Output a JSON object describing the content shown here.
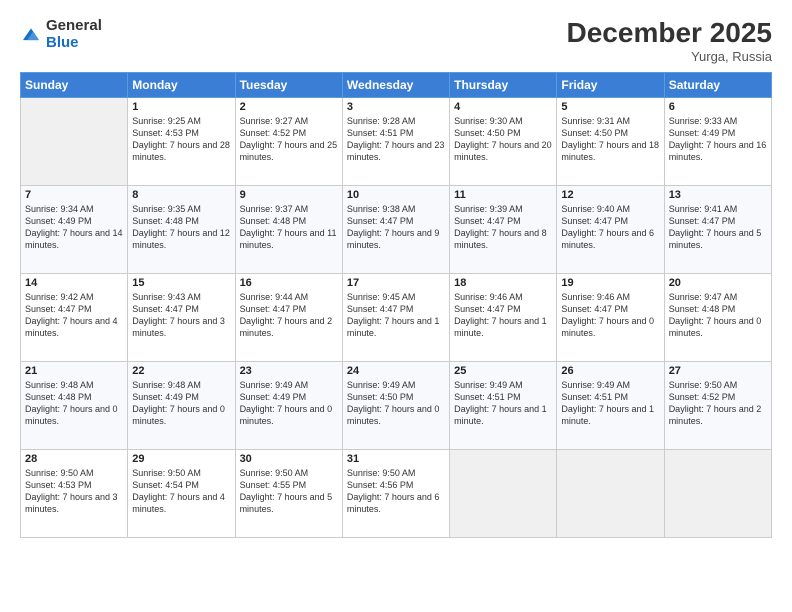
{
  "logo": {
    "general": "General",
    "blue": "Blue"
  },
  "title": "December 2025",
  "location": "Yurga, Russia",
  "headers": [
    "Sunday",
    "Monday",
    "Tuesday",
    "Wednesday",
    "Thursday",
    "Friday",
    "Saturday"
  ],
  "weeks": [
    [
      {
        "day": "",
        "sunrise": "",
        "sunset": "",
        "daylight": ""
      },
      {
        "day": "1",
        "sunrise": "Sunrise: 9:25 AM",
        "sunset": "Sunset: 4:53 PM",
        "daylight": "Daylight: 7 hours and 28 minutes."
      },
      {
        "day": "2",
        "sunrise": "Sunrise: 9:27 AM",
        "sunset": "Sunset: 4:52 PM",
        "daylight": "Daylight: 7 hours and 25 minutes."
      },
      {
        "day": "3",
        "sunrise": "Sunrise: 9:28 AM",
        "sunset": "Sunset: 4:51 PM",
        "daylight": "Daylight: 7 hours and 23 minutes."
      },
      {
        "day": "4",
        "sunrise": "Sunrise: 9:30 AM",
        "sunset": "Sunset: 4:50 PM",
        "daylight": "Daylight: 7 hours and 20 minutes."
      },
      {
        "day": "5",
        "sunrise": "Sunrise: 9:31 AM",
        "sunset": "Sunset: 4:50 PM",
        "daylight": "Daylight: 7 hours and 18 minutes."
      },
      {
        "day": "6",
        "sunrise": "Sunrise: 9:33 AM",
        "sunset": "Sunset: 4:49 PM",
        "daylight": "Daylight: 7 hours and 16 minutes."
      }
    ],
    [
      {
        "day": "7",
        "sunrise": "Sunrise: 9:34 AM",
        "sunset": "Sunset: 4:49 PM",
        "daylight": "Daylight: 7 hours and 14 minutes."
      },
      {
        "day": "8",
        "sunrise": "Sunrise: 9:35 AM",
        "sunset": "Sunset: 4:48 PM",
        "daylight": "Daylight: 7 hours and 12 minutes."
      },
      {
        "day": "9",
        "sunrise": "Sunrise: 9:37 AM",
        "sunset": "Sunset: 4:48 PM",
        "daylight": "Daylight: 7 hours and 11 minutes."
      },
      {
        "day": "10",
        "sunrise": "Sunrise: 9:38 AM",
        "sunset": "Sunset: 4:47 PM",
        "daylight": "Daylight: 7 hours and 9 minutes."
      },
      {
        "day": "11",
        "sunrise": "Sunrise: 9:39 AM",
        "sunset": "Sunset: 4:47 PM",
        "daylight": "Daylight: 7 hours and 8 minutes."
      },
      {
        "day": "12",
        "sunrise": "Sunrise: 9:40 AM",
        "sunset": "Sunset: 4:47 PM",
        "daylight": "Daylight: 7 hours and 6 minutes."
      },
      {
        "day": "13",
        "sunrise": "Sunrise: 9:41 AM",
        "sunset": "Sunset: 4:47 PM",
        "daylight": "Daylight: 7 hours and 5 minutes."
      }
    ],
    [
      {
        "day": "14",
        "sunrise": "Sunrise: 9:42 AM",
        "sunset": "Sunset: 4:47 PM",
        "daylight": "Daylight: 7 hours and 4 minutes."
      },
      {
        "day": "15",
        "sunrise": "Sunrise: 9:43 AM",
        "sunset": "Sunset: 4:47 PM",
        "daylight": "Daylight: 7 hours and 3 minutes."
      },
      {
        "day": "16",
        "sunrise": "Sunrise: 9:44 AM",
        "sunset": "Sunset: 4:47 PM",
        "daylight": "Daylight: 7 hours and 2 minutes."
      },
      {
        "day": "17",
        "sunrise": "Sunrise: 9:45 AM",
        "sunset": "Sunset: 4:47 PM",
        "daylight": "Daylight: 7 hours and 1 minute."
      },
      {
        "day": "18",
        "sunrise": "Sunrise: 9:46 AM",
        "sunset": "Sunset: 4:47 PM",
        "daylight": "Daylight: 7 hours and 1 minute."
      },
      {
        "day": "19",
        "sunrise": "Sunrise: 9:46 AM",
        "sunset": "Sunset: 4:47 PM",
        "daylight": "Daylight: 7 hours and 0 minutes."
      },
      {
        "day": "20",
        "sunrise": "Sunrise: 9:47 AM",
        "sunset": "Sunset: 4:48 PM",
        "daylight": "Daylight: 7 hours and 0 minutes."
      }
    ],
    [
      {
        "day": "21",
        "sunrise": "Sunrise: 9:48 AM",
        "sunset": "Sunset: 4:48 PM",
        "daylight": "Daylight: 7 hours and 0 minutes."
      },
      {
        "day": "22",
        "sunrise": "Sunrise: 9:48 AM",
        "sunset": "Sunset: 4:49 PM",
        "daylight": "Daylight: 7 hours and 0 minutes."
      },
      {
        "day": "23",
        "sunrise": "Sunrise: 9:49 AM",
        "sunset": "Sunset: 4:49 PM",
        "daylight": "Daylight: 7 hours and 0 minutes."
      },
      {
        "day": "24",
        "sunrise": "Sunrise: 9:49 AM",
        "sunset": "Sunset: 4:50 PM",
        "daylight": "Daylight: 7 hours and 0 minutes."
      },
      {
        "day": "25",
        "sunrise": "Sunrise: 9:49 AM",
        "sunset": "Sunset: 4:51 PM",
        "daylight": "Daylight: 7 hours and 1 minute."
      },
      {
        "day": "26",
        "sunrise": "Sunrise: 9:49 AM",
        "sunset": "Sunset: 4:51 PM",
        "daylight": "Daylight: 7 hours and 1 minute."
      },
      {
        "day": "27",
        "sunrise": "Sunrise: 9:50 AM",
        "sunset": "Sunset: 4:52 PM",
        "daylight": "Daylight: 7 hours and 2 minutes."
      }
    ],
    [
      {
        "day": "28",
        "sunrise": "Sunrise: 9:50 AM",
        "sunset": "Sunset: 4:53 PM",
        "daylight": "Daylight: 7 hours and 3 minutes."
      },
      {
        "day": "29",
        "sunrise": "Sunrise: 9:50 AM",
        "sunset": "Sunset: 4:54 PM",
        "daylight": "Daylight: 7 hours and 4 minutes."
      },
      {
        "day": "30",
        "sunrise": "Sunrise: 9:50 AM",
        "sunset": "Sunset: 4:55 PM",
        "daylight": "Daylight: 7 hours and 5 minutes."
      },
      {
        "day": "31",
        "sunrise": "Sunrise: 9:50 AM",
        "sunset": "Sunset: 4:56 PM",
        "daylight": "Daylight: 7 hours and 6 minutes."
      },
      {
        "day": "",
        "sunrise": "",
        "sunset": "",
        "daylight": ""
      },
      {
        "day": "",
        "sunrise": "",
        "sunset": "",
        "daylight": ""
      },
      {
        "day": "",
        "sunrise": "",
        "sunset": "",
        "daylight": ""
      }
    ]
  ]
}
